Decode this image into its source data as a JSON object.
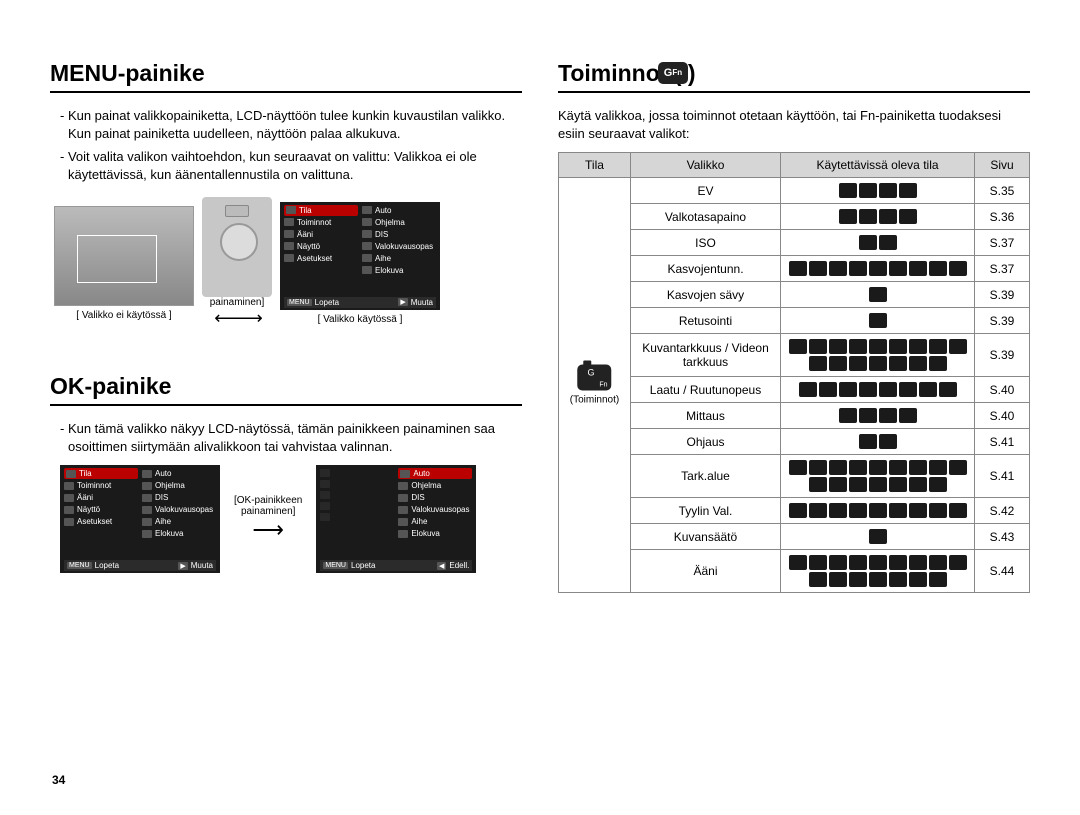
{
  "page_number": "34",
  "left": {
    "section1_title": "MENU-painike",
    "s1_p1": "- Kun painat valikkopainiketta, LCD-näyttöön tulee kunkin kuvaustilan valikko. Kun painat painiketta uudelleen, näyttöön palaa alkukuva.",
    "s1_p2": "- Voit valita valikon vaihtoehdon, kun seuraavat on valittu: Valikkoa ei ole käytettävissä, kun äänentallennustila on valittuna.",
    "fig1_caption": "[ Valikko ei käytössä ]",
    "fig2_caption": "[ Valikko käytössä ]",
    "arrow_label_top": "painaminen]",
    "section2_title": "OK-painike",
    "s2_p1": "- Kun tämä valikko näkyy LCD-näytössä, tämän painikkeen painaminen saa osoittimen siirtymään alivalikkoon tai vahvistaa valinnan.",
    "ok_arrow_top": "[OK-painikkeen",
    "ok_arrow_bottom": "painaminen]"
  },
  "menu_items_left": [
    "Tila",
    "Toiminnot",
    "Ääni",
    "Näyttö",
    "Asetukset"
  ],
  "menu_items_right": [
    "Auto",
    "Ohjelma",
    "DIS",
    "Valokuvausopas",
    "Aihe",
    "Elokuva"
  ],
  "menu_foot_left": "Lopeta",
  "menu_foot_right": "Muuta",
  "menu_foot_right2": "Edell.",
  "right": {
    "title": "Toiminnot (      )",
    "intro": "Käytä valikkoa, jossa toiminnot otetaan käyttöön, tai Fn-painiketta tuodaksesi esiin seuraavat valikot:",
    "headers": {
      "mode": "Tila",
      "menu": "Valikko",
      "avail": "Käytettävissä oleva tila",
      "page": "Sivu"
    },
    "mode_label": "(Toiminnot)",
    "rows": [
      {
        "menu": "EV",
        "page": "S.35",
        "chips": 4
      },
      {
        "menu": "Valkotasapaino",
        "page": "S.36",
        "chips": 4
      },
      {
        "menu": "ISO",
        "page": "S.37",
        "chips": 2
      },
      {
        "menu": "Kasvojentunn.",
        "page": "S.37",
        "chips": 9
      },
      {
        "menu": "Kasvojen sävy",
        "page": "S.39",
        "chips": 1
      },
      {
        "menu": "Retusointi",
        "page": "S.39",
        "chips": 1
      },
      {
        "menu": "Kuvantarkkuus / Videon tarkkuus",
        "page": "S.39",
        "chips": 16
      },
      {
        "menu": "Laatu / Ruutunopeus",
        "page": "S.40",
        "chips": 8
      },
      {
        "menu": "Mittaus",
        "page": "S.40",
        "chips": 4
      },
      {
        "menu": "Ohjaus",
        "page": "S.41",
        "chips": 2
      },
      {
        "menu": "Tark.alue",
        "page": "S.41",
        "chips": 16
      },
      {
        "menu": "Tyylin Val.",
        "page": "S.42",
        "chips": 9
      },
      {
        "menu": "Kuvansäätö",
        "page": "S.43",
        "chips": 1
      },
      {
        "menu": "Ääni",
        "page": "S.44",
        "chips": 16
      }
    ]
  }
}
